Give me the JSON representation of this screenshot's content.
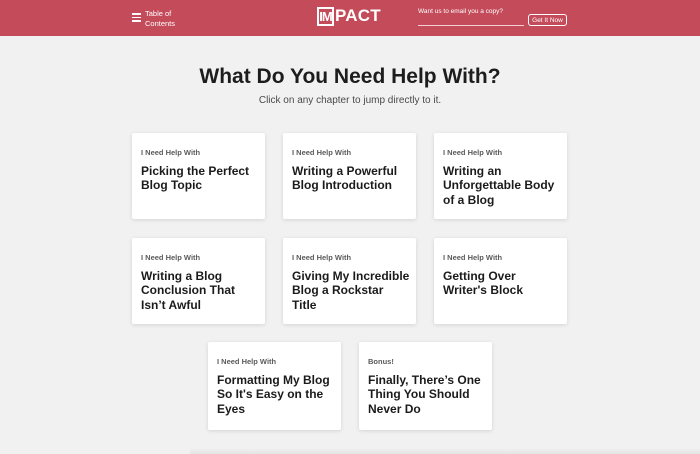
{
  "header": {
    "toc_label": "Table of Contents",
    "logo_box": "IM",
    "logo_text": "PACT",
    "email_label": "Want us to email you a copy?",
    "email_placeholder": "",
    "email_button": "Get It Now",
    "brand_color": "#c44b5a"
  },
  "main": {
    "title": "What Do You Need Help With?",
    "subtitle": "Click on any chapter to jump directly to it."
  },
  "cards": [
    {
      "eyebrow": "I Need Help With",
      "title": "Picking the Perfect Blog Topic"
    },
    {
      "eyebrow": "I Need Help With",
      "title": "Writing a Powerful Blog Introduction"
    },
    {
      "eyebrow": "I Need Help With",
      "title": "Writing an Unforgettable Body of a Blog"
    },
    {
      "eyebrow": "I Need Help With",
      "title": "Writing a Blog Conclusion That Isn’t Awful"
    },
    {
      "eyebrow": "I Need Help With",
      "title": "Giving My Incredible Blog a Rockstar Title"
    },
    {
      "eyebrow": "I Need Help With",
      "title": "Getting Over Writer's Block"
    },
    {
      "eyebrow": "I Need Help With",
      "title": "Formatting My Blog So It's Easy on the Eyes"
    },
    {
      "eyebrow": "Bonus!",
      "title": "Finally, There’s One Thing You Should Never Do"
    }
  ]
}
